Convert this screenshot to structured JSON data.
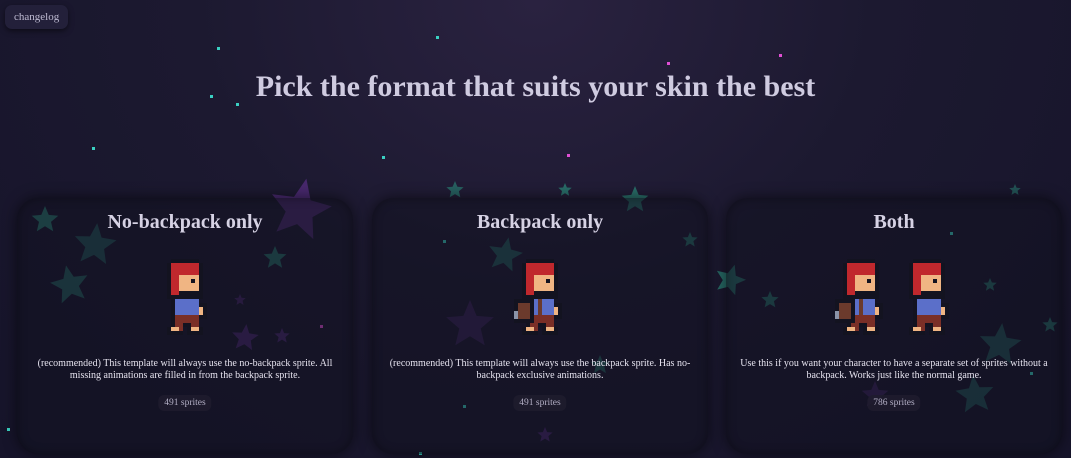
{
  "changelog_label": "changelog",
  "headline": "Pick the format that suits your skin the best",
  "options": [
    {
      "title": "No-backpack only",
      "description": "(recommended) This template will always use the no-backpack sprite. All missing animations are filled in from the backpack sprite.",
      "count": "491 sprites",
      "sprites": [
        "no-backpack"
      ]
    },
    {
      "title": "Backpack only",
      "description": "(recommended) This template will always use the backpack sprite. Has no-backpack exclusive animations.",
      "count": "491 sprites",
      "sprites": [
        "backpack"
      ]
    },
    {
      "title": "Both",
      "description": "Use this if you want your character to have a separate set of sprites without a backpack. Works just like the normal game.",
      "count": "786 sprites",
      "sprites": [
        "backpack",
        "no-backpack"
      ]
    }
  ],
  "colors": {
    "hair": "#c0282d",
    "outline": "#131320",
    "skin": "#f0b583",
    "shirt": "#5b6fc9",
    "pants": "#7a2f27",
    "backpack": "#6b3a2c",
    "star_teal": "#2c8c7c",
    "star_purple": "#5a2f86"
  }
}
